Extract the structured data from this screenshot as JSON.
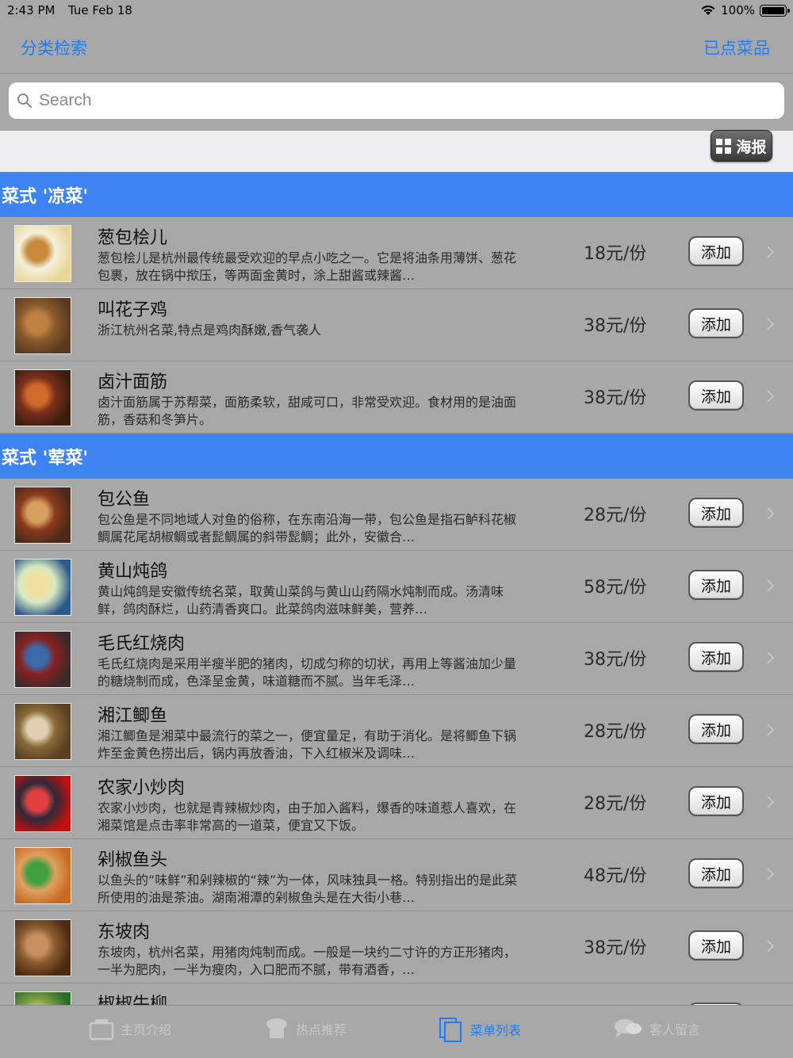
{
  "status_bar": {
    "time": "2:43 PM",
    "date": "Tue Feb 18",
    "battery": "100%"
  },
  "nav": {
    "left_button": "分类检索",
    "right_button": "已点菜品"
  },
  "search": {
    "placeholder": "Search"
  },
  "poster_button": "海报",
  "add_label": "添加",
  "sections": [
    {
      "title": "菜式 '凉菜'",
      "items": [
        {
          "name": "葱包桧儿",
          "desc": "葱包桧儿是杭州最传统最受欢迎的早点小吃之一。它是将油条用薄饼、葱花包裹，放在锅中揿压，等两面金黄时，涂上甜酱或辣酱…",
          "price": "18元/份"
        },
        {
          "name": "叫花子鸡",
          "desc": "浙江杭州名菜,特点是鸡肉酥嫩,香气袭人",
          "price": "38元/份"
        },
        {
          "name": "卤汁面筋",
          "desc": "卤汁面筋属于苏帮菜，面筋柔软，甜咸可口，非常受欢迎。食材用的是油面筋，香菇和冬笋片。",
          "price": "38元/份"
        }
      ]
    },
    {
      "title": "菜式 '荤菜'",
      "items": [
        {
          "name": "包公鱼",
          "desc": "包公鱼是不同地域人对鱼的俗称，在东南沿海一带，包公鱼是指石鲈科花椒鲷属花尾胡椒鲷或者髭鲷属的斜带髭鲷；此外，安徽合…",
          "price": "28元/份"
        },
        {
          "name": "黄山炖鸽",
          "desc": "黄山炖鸽是安徽传统名菜，取黄山菜鸽与黄山山药隔水炖制而成。汤清味鲜，鸽肉酥烂，山药清香爽口。此菜鸽肉滋味鲜美，营养…",
          "price": "58元/份"
        },
        {
          "name": "毛氏红烧肉",
          "desc": "毛氏红烧肉是采用半瘦半肥的猪肉，切成匀称的切状，再用上等酱油加少量的糖烧制而成，色泽呈金黄，味道糖而不腻。当年毛泽…",
          "price": "38元/份"
        },
        {
          "name": "湘江鲫鱼",
          "desc": "湘江鲫鱼是湘菜中最流行的菜之一，便宜量足，有助于消化。是将鲫鱼下锅炸至金黄色捞出后，锅内再放香油，下入红椒米及调味…",
          "price": "28元/份"
        },
        {
          "name": "农家小炒肉",
          "desc": "农家小炒肉，也就是青辣椒炒肉，由于加入酱料，爆香的味道惹人喜欢，在湘菜馆是点击率非常高的一道菜，便宜又下饭。",
          "price": "28元/份"
        },
        {
          "name": "剁椒鱼头",
          "desc": "以鱼头的“味鲜”和剁辣椒的“辣”为一体，风味独具一格。特别指出的是此菜所使用的油是茶油。湖南湘潭的剁椒鱼头是在大街小巷…",
          "price": "48元/份"
        },
        {
          "name": "东坡肉",
          "desc": "东坡肉，杭州名菜，用猪肉炖制而成。一般是一块约二寸许的方正形猪肉，一半为肥肉，一半为瘦肉，入口肥而不腻，带有酒香，…",
          "price": "38元/份"
        },
        {
          "name": "椒椒牛柳",
          "desc": "",
          "price": ""
        }
      ]
    }
  ],
  "tabs": [
    {
      "label": "主页介绍",
      "icon": "home-box-icon",
      "active": false
    },
    {
      "label": "热点推荐",
      "icon": "chef-hat-icon",
      "active": false
    },
    {
      "label": "菜单列表",
      "icon": "menu-list-icon",
      "active": true
    },
    {
      "label": "客人留言",
      "icon": "speech-bubbles-icon",
      "active": false
    }
  ],
  "colors": {
    "accent": "#1a7cff",
    "section_header": "#3d84f2",
    "background": "#a8a8a8"
  }
}
